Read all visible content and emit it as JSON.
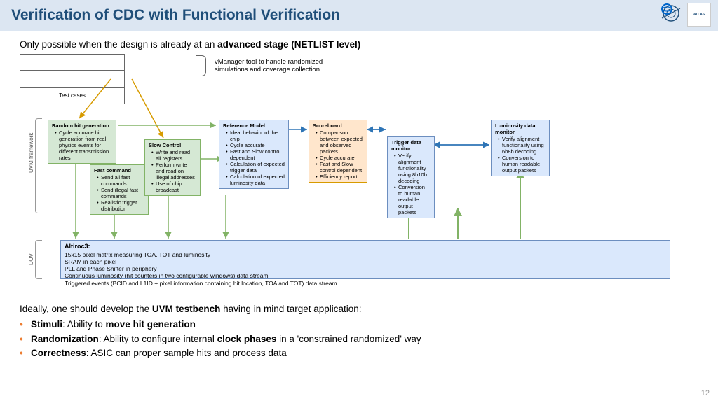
{
  "header": {
    "title": "Verification of CDC with Functional Verification"
  },
  "logos": {
    "cern": "CERN",
    "atlas": "ATLAS"
  },
  "subtitle_pre": "Only possible when the design is already at an ",
  "subtitle_bold": "advanced stage (NETLIST level)",
  "testcases": "Test cases",
  "vmanager": "vManager tool to handle randomized simulations and coverage collection",
  "labels": {
    "uvm": "UVM framework",
    "duv": "DUV"
  },
  "boxes": {
    "rhg": {
      "title": "Random hit generation",
      "items": [
        "Cycle accurate hit generation from real physics events for different transmission rates"
      ]
    },
    "fc": {
      "title": "Fast command",
      "items": [
        "Send all fast commands",
        "Send illegal fast commands",
        "Realistic trigger distribution"
      ]
    },
    "sc": {
      "title": "Slow Control",
      "items": [
        "Write and read all registers",
        "Perform write and read on illegal addresses",
        "Use of chip broadcast"
      ]
    },
    "rm": {
      "title": "Reference Model",
      "items": [
        "Ideal behavior of the chip",
        "Cycle accurate",
        "Fast and Slow control dependent",
        "Calculation of expected trigger data",
        "Calculation of expected luminosity data"
      ]
    },
    "sb": {
      "title": "Scoreboard",
      "items": [
        "Comparison between expected and observed packets",
        "Cycle accurate",
        "Fast and Slow control dependent",
        "Efficiency report"
      ]
    },
    "tdm": {
      "title": "Trigger data monitor",
      "items": [
        "Verify alignment functionality using 8b10b decoding",
        "Conversion to human readable output packets"
      ]
    },
    "ldm": {
      "title": "Luminosity data monitor",
      "items": [
        "Verify alignment functionality using 6b8b decoding",
        "Conversion to human readable output packets"
      ]
    },
    "altiroc": {
      "title": "Altiroc3:",
      "items": [
        "15x15 pixel matrix measuring TOA, TOT and luminosity",
        "SRAM in each pixel",
        "PLL and Phase Shifter in periphery",
        "Continuous luminosity (hit counters in two configurable windows) data stream",
        "Triggered events (BCID and L1ID + pixel information containing hit location, TOA and TOT) data stream"
      ]
    }
  },
  "bottom": {
    "intro_pre": "Ideally, one should develop the ",
    "intro_bold": "UVM testbench",
    "intro_post": " having in mind target application:",
    "stimuli": {
      "b1": "Stimuli",
      "t1": ": Ability to ",
      "b2": "move hit generation"
    },
    "random": {
      "b1": "Randomization",
      "t1": ": Ability to configure internal ",
      "b2": "clock phases",
      "t2": " in a 'constrained randomized' way"
    },
    "correct": {
      "b1": "Correctness",
      "t1": ": ASIC can proper sample hits and process data"
    }
  },
  "pagenum": "12"
}
